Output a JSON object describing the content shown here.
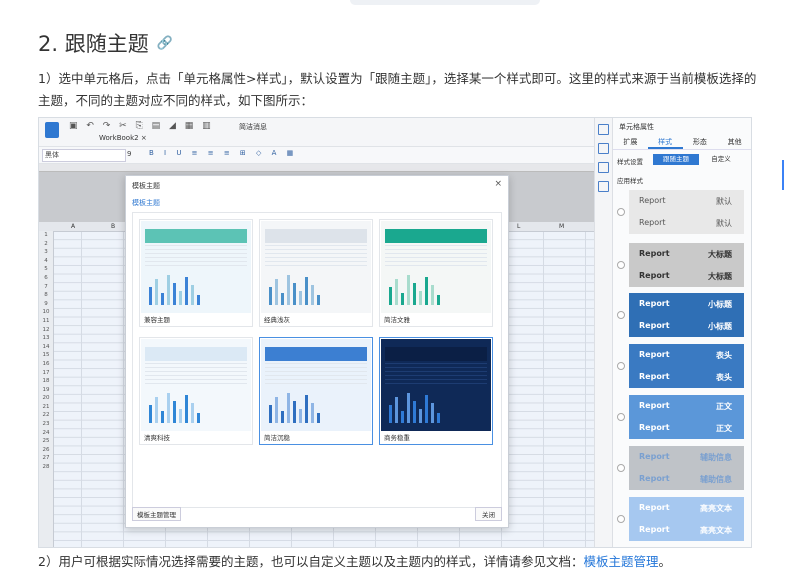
{
  "heading": {
    "title": "2. 跟随主题",
    "link_icon": "link-icon"
  },
  "paragraph1": "1）选中单元格后，点击「单元格属性>样式」，默认设置为「跟随主题」，选择某一个样式即可。这里的样式来源于当前模板选择的主题，不同的主题对应不同的样式，如下图所示：",
  "paragraph2": {
    "text": "2）用户可根据实际情况选择需要的主题，也可以自定义主题以及主题内的样式，详情请参见文档：",
    "link": "模板主题管理",
    "tail": "。"
  },
  "screenshot": {
    "toolbar": {
      "tab_label": "WorkBook2 ×",
      "font_value": "黑体",
      "font_size": "9",
      "preview_label": "简洁消息"
    },
    "right_panel": {
      "title": "单元格属性",
      "tabs": [
        "扩展",
        "样式",
        "形态",
        "其他"
      ],
      "active_tab": "样式",
      "style_setting_label": "样式设置",
      "mode_options": [
        "跟随主题",
        "自定义"
      ],
      "active_mode": "跟随主题",
      "apply_label": "应用样式",
      "styles": [
        {
          "left": "Report",
          "right": "默认",
          "bg": "#e8e8e8",
          "fg": "#555"
        },
        {
          "left": "Report",
          "right": "大标题",
          "bg": "#c9c9c9",
          "fg": "#333"
        },
        {
          "left": "Report",
          "right": "小标题",
          "bg": "#2f6fb5",
          "fg": "#ffffff"
        },
        {
          "left": "Report",
          "right": "表头",
          "bg": "#3a7ac2",
          "fg": "#ffffff"
        },
        {
          "left": "Report",
          "right": "正文",
          "bg": "#5b97d9",
          "fg": "#ffffff"
        },
        {
          "left": "Report",
          "right": "辅助信息",
          "bg": "#bfc3c8",
          "fg": "#7aa0d0"
        },
        {
          "left": "Report",
          "right": "高亮文本",
          "bg": "#a6c8f0",
          "fg": "#ffffff"
        }
      ]
    },
    "modal": {
      "title": "模板主题",
      "subtitle": "模板主题",
      "close": "×",
      "themes": [
        "兼容主题",
        "经典浅灰",
        "简洁文雅",
        "清爽科技",
        "简洁沉稳",
        "商务稳重"
      ],
      "manage_button": "模板主题管理",
      "close_button": "关闭"
    },
    "columns": [
      "A",
      "B",
      "L",
      "M"
    ],
    "rows": [
      "1",
      "2",
      "3",
      "4",
      "5",
      "6",
      "7",
      "8",
      "9",
      "10",
      "11",
      "12",
      "13",
      "14",
      "15",
      "16",
      "17",
      "18",
      "19",
      "20",
      "21",
      "22",
      "23",
      "24",
      "25",
      "26",
      "27",
      "28"
    ]
  },
  "colors": {
    "accent": "#2f78d1",
    "link": "#2577d9"
  }
}
